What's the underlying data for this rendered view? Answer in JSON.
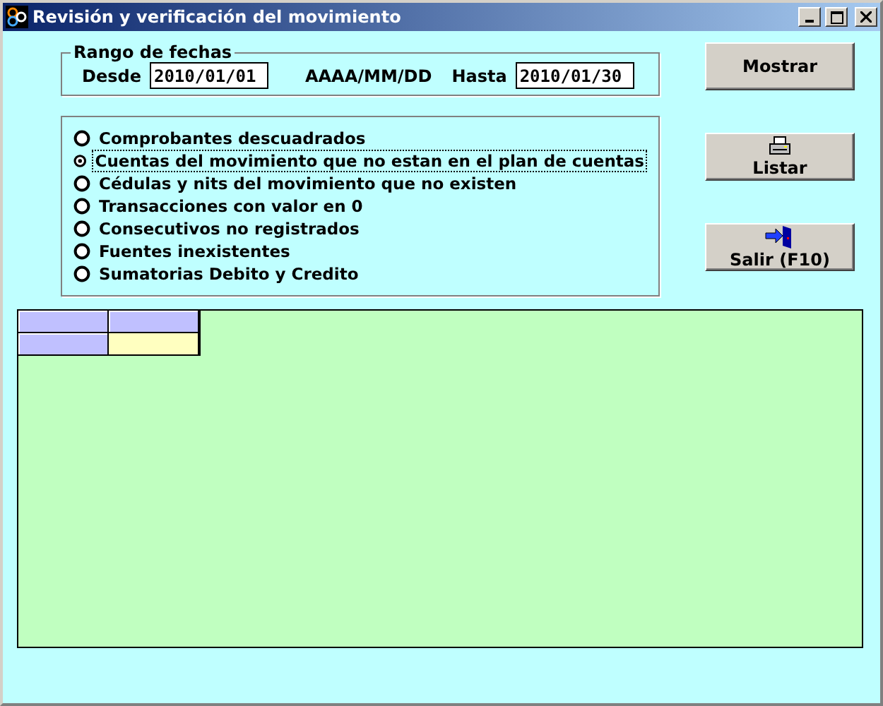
{
  "window": {
    "title": "Revisión y verificación del movimiento"
  },
  "date_range": {
    "legend": "Rango de fechas",
    "from_label": "Desde",
    "from_value": "2010/01/01",
    "format_hint": "AAAA/MM/DD",
    "to_label": "Hasta",
    "to_value": "2010/01/30"
  },
  "options": [
    {
      "label": "Comprobantes descuadrados",
      "selected": false
    },
    {
      "label": "Cuentas del movimiento que no estan en el plan de cuentas",
      "selected": true
    },
    {
      "label": "Cédulas y nits del movimiento que no existen",
      "selected": false
    },
    {
      "label": "Transacciones con valor en 0",
      "selected": false
    },
    {
      "label": "Consecutivos no registrados",
      "selected": false
    },
    {
      "label": "Fuentes inexistentes",
      "selected": false
    },
    {
      "label": "Sumatorias Debito y Credito",
      "selected": false
    }
  ],
  "buttons": [
    {
      "label": "Mostrar",
      "kind": "plain"
    },
    {
      "label": "Listar",
      "kind": "printer"
    },
    {
      "label": "Salir (F10)",
      "kind": "exit"
    }
  ],
  "grid": {
    "rows": [
      [
        {
          "kind": "header"
        },
        {
          "kind": "header"
        }
      ],
      [
        {
          "kind": "header"
        },
        {
          "kind": "current"
        }
      ]
    ]
  }
}
